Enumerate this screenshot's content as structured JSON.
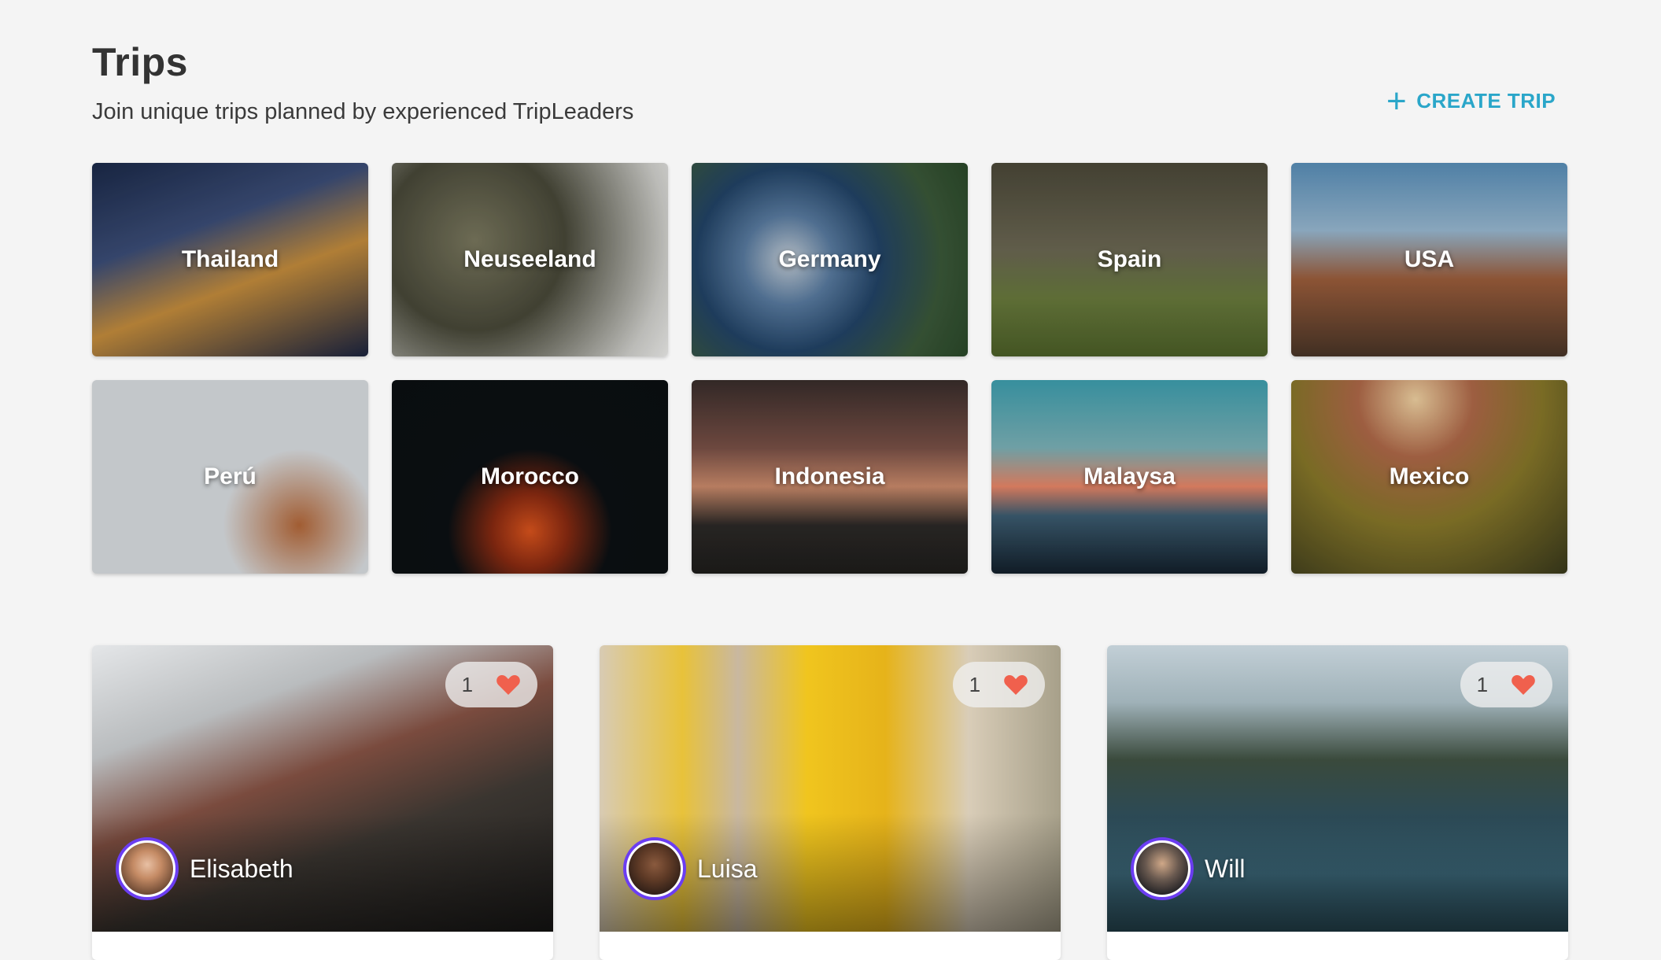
{
  "header": {
    "title": "Trips",
    "subtitle": "Join unique trips planned by experienced TripLeaders",
    "create_label": "CREATE TRIP",
    "create_icon": "plus-icon",
    "accent": "#2aa6c9"
  },
  "destinations": [
    {
      "name": "Thailand"
    },
    {
      "name": "Neuseeland"
    },
    {
      "name": "Germany"
    },
    {
      "name": "Spain"
    },
    {
      "name": "USA"
    },
    {
      "name": "Perú"
    },
    {
      "name": "Morocco"
    },
    {
      "name": "Indonesia"
    },
    {
      "name": "Malaysa"
    },
    {
      "name": "Mexico"
    }
  ],
  "trips": [
    {
      "leader": "Elisabeth",
      "likes": "1"
    },
    {
      "leader": "Luisa",
      "likes": "1"
    },
    {
      "leader": "Will",
      "likes": "1"
    }
  ],
  "colors": {
    "heart": "#f0604d",
    "avatar_ring": "#6b3df2"
  }
}
